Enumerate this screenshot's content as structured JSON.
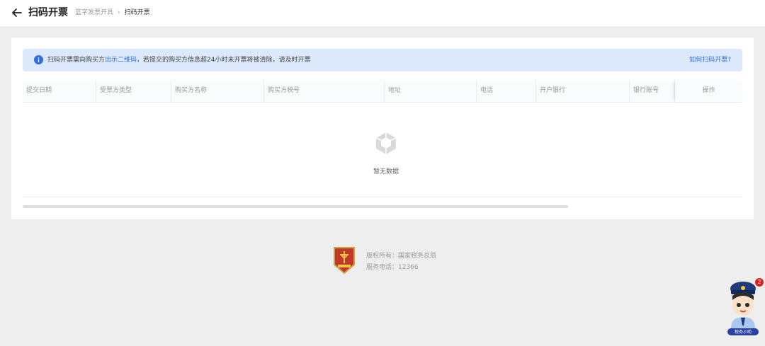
{
  "header": {
    "title": "扫码开票",
    "breadcrumb": [
      "蓝字发票开具",
      "扫码开票"
    ],
    "breadcrumb_separator": "›"
  },
  "notice": {
    "text_before": "扫码开票需向购买方",
    "highlight": "出示二维码",
    "text_after": "，若提交的购买方信息超24小时未开票将被清除，请及时开票",
    "help_link": "如何扫码开票?"
  },
  "table": {
    "columns": [
      "提交日期",
      "受票方类型",
      "购买方名称",
      "购买方税号",
      "地址",
      "电话",
      "开户银行",
      "银行账号",
      "操作"
    ],
    "rows": [],
    "empty_text": "暂无数据"
  },
  "footer": {
    "copyright": "版权所有：国家税务总局",
    "phone": "服务电话：12366"
  },
  "assistant": {
    "badge_count": "2",
    "label": "税务小助"
  },
  "colors": {
    "accent": "#2f6fe4",
    "notice_bg": "#dbe9fb",
    "page_bg": "#eeeeee",
    "badge": "#e02020",
    "emblem_red": "#c0392b"
  },
  "icons": {
    "back": "arrow-left-icon",
    "info": "info-circle-icon",
    "empty": "empty-box-icon",
    "emblem": "tax-bureau-emblem-icon"
  }
}
